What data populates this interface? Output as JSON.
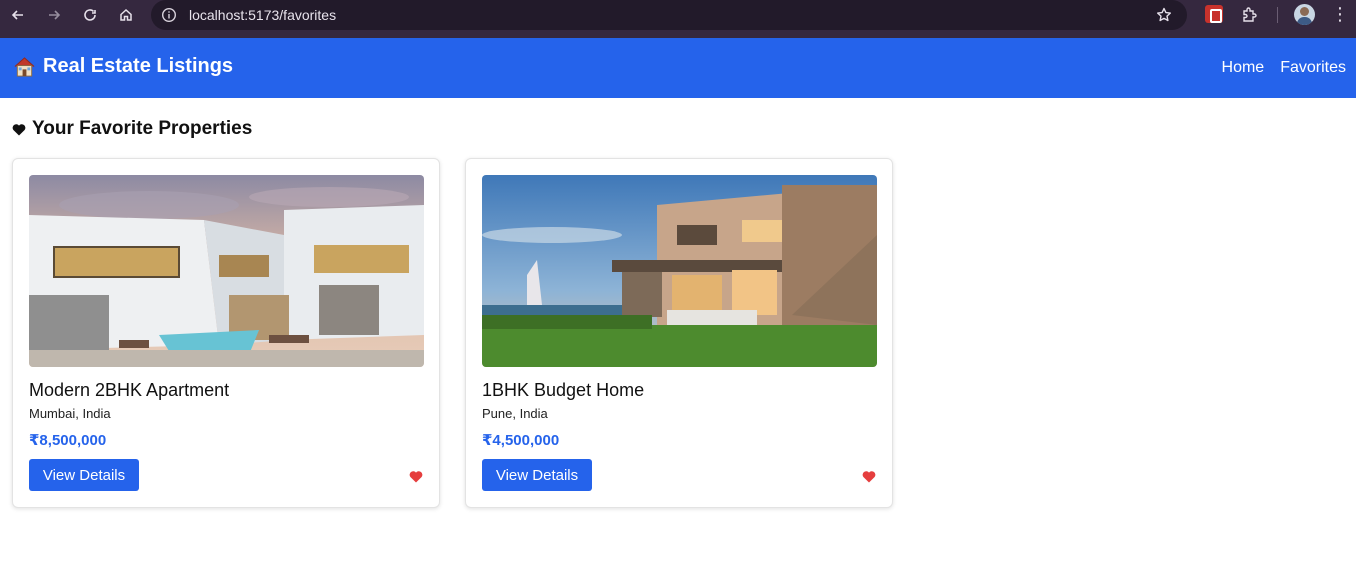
{
  "browser": {
    "url": "localhost:5173/favorites"
  },
  "header": {
    "brand": "Real Estate Listings",
    "brand_icon": "house-icon",
    "nav": [
      {
        "label": "Home"
      },
      {
        "label": "Favorites"
      }
    ],
    "bg_color": "#2563eb"
  },
  "main": {
    "title": "Your Favorite Properties",
    "title_icon": "heart-icon"
  },
  "properties": [
    {
      "name": "Modern 2BHK Apartment",
      "location": "Mumbai, India",
      "price": "₹8,500,000",
      "button": "View Details",
      "favorite": true
    },
    {
      "name": "1BHK Budget Home",
      "location": "Pune, India",
      "price": "₹4,500,000",
      "button": "View Details",
      "favorite": true
    }
  ],
  "colors": {
    "accent": "#2563eb",
    "favorite_heart": "#e53e3e"
  }
}
